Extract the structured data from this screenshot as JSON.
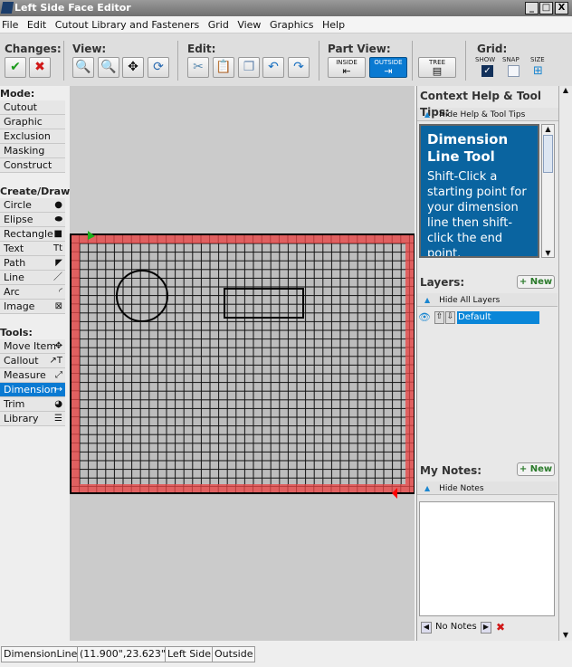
{
  "window": {
    "title": "Left Side Face Editor",
    "minimize": "_",
    "maximize": "□",
    "close": "X"
  },
  "menu": [
    "File",
    "Edit",
    "Cutout Library and Fasteners",
    "Grid",
    "View",
    "Graphics",
    "Help"
  ],
  "toolbar": {
    "changes_label": "Changes:",
    "view_label": "View:",
    "edit_label": "Edit:",
    "partview_label": "Part View:",
    "grid_label": "Grid:",
    "inside": "INSIDE",
    "outside": "OUTSIDE",
    "tree": "TREE",
    "show": "SHOW",
    "snap": "SNAP",
    "size": "SIZE",
    "show_checked": true,
    "snap_checked": false,
    "active_part_view": "OUTSIDE"
  },
  "sidebar": {
    "mode_label": "Mode:",
    "modes": [
      "Cutout",
      "Graphic",
      "Exclusion",
      "Masking",
      "Construct"
    ],
    "create_label": "Create/Draw:",
    "create": [
      {
        "label": "Circle",
        "icon": "●"
      },
      {
        "label": "Elipse",
        "icon": "⬬"
      },
      {
        "label": "Rectangle",
        "icon": "■"
      },
      {
        "label": "Text",
        "icon": "Tt"
      },
      {
        "label": "Path",
        "icon": "◤"
      },
      {
        "label": "Line",
        "icon": "／"
      },
      {
        "label": "Arc",
        "icon": "◜"
      },
      {
        "label": "Image",
        "icon": "⊠"
      }
    ],
    "tools_label": "Tools:",
    "tools": [
      {
        "label": "Move Item",
        "icon": "✥"
      },
      {
        "label": "Callout",
        "icon": "↗T"
      },
      {
        "label": "Measure",
        "icon": "⤢"
      },
      {
        "label": "Dimension",
        "icon": "↦"
      },
      {
        "label": "Trim",
        "icon": "◕"
      },
      {
        "label": "Library",
        "icon": "☰"
      }
    ],
    "selected_tool": "Dimension"
  },
  "right": {
    "help_title": "Context Help & Tool Tips:",
    "hide_help": "Hide Help & Tool Tips",
    "help_heading": "Dimension Line Tool",
    "help_text": "Shift-Click a starting point for your dimension line then shift-click the end point.",
    "layers_title": "Layers:",
    "new": "+ New",
    "hide_layers": "Hide All Layers",
    "layers": [
      "Default"
    ],
    "notes_title": "My Notes:",
    "hide_notes": "Hide Notes",
    "no_notes": "No Notes"
  },
  "status": {
    "mode": "DimensionLines",
    "coords": "(11.900\",23.623\")",
    "side": "Left Side",
    "view": "Outside"
  },
  "colors": {
    "accent": "#0a7ad2",
    "help_bg": "#0a64a0",
    "panel_border": "#e06060",
    "grid_fill": "#bdbdbd"
  }
}
